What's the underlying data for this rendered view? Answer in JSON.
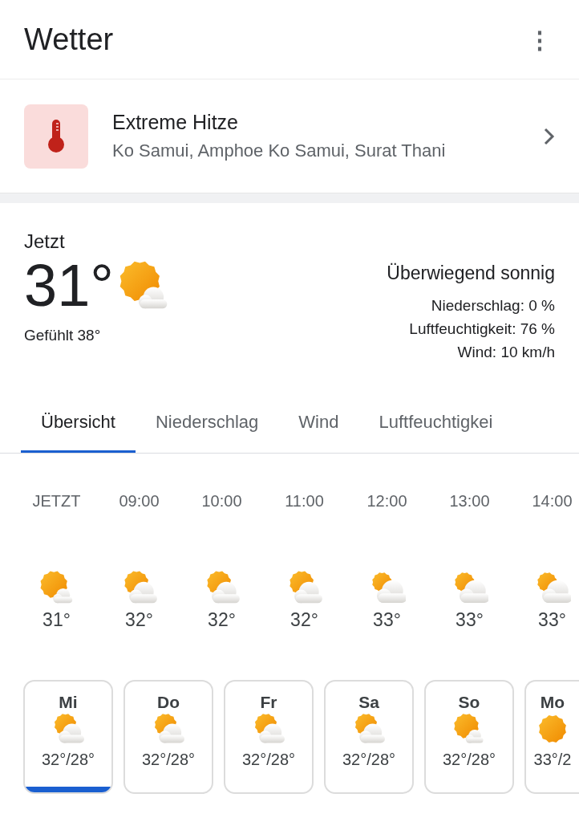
{
  "app_bar": {
    "title": "Wetter",
    "menu_icon": "⋮"
  },
  "alert": {
    "title": "Extreme Hitze",
    "location": "Ko Samui, Amphoe Ko Samui, Surat Thani"
  },
  "current": {
    "label": "Jetzt",
    "temperature": "31°",
    "kind": "mostly-sunny",
    "feels_like": "Gefühlt 38°",
    "condition": "Überwiegend sonnig",
    "details": [
      "Niederschlag: 0 %",
      "Luftfeuchtigkeit: 76 %",
      "Wind: 10 km/h"
    ]
  },
  "tabs": [
    {
      "label": "Übersicht",
      "selected": true
    },
    {
      "label": "Niederschlag",
      "selected": false
    },
    {
      "label": "Wind",
      "selected": false
    },
    {
      "label": "Luftfeuchtigkei",
      "selected": false
    }
  ],
  "hourly": [
    {
      "time": "JETZT",
      "kind": "mostly-sunny",
      "temp": "31°"
    },
    {
      "time": "09:00",
      "kind": "partly-cloudy",
      "temp": "32°"
    },
    {
      "time": "10:00",
      "kind": "partly-cloudy",
      "temp": "32°"
    },
    {
      "time": "11:00",
      "kind": "partly-cloudy",
      "temp": "32°"
    },
    {
      "time": "12:00",
      "kind": "cloudy-sun",
      "temp": "33°"
    },
    {
      "time": "13:00",
      "kind": "cloudy-sun",
      "temp": "33°"
    },
    {
      "time": "14:00",
      "kind": "cloudy-sun",
      "temp": "33°"
    }
  ],
  "days": [
    {
      "day": "Mi",
      "kind": "partly-cloudy",
      "range": "32°/28°",
      "selected": true
    },
    {
      "day": "Do",
      "kind": "partly-cloudy",
      "range": "32°/28°",
      "selected": false
    },
    {
      "day": "Fr",
      "kind": "partly-cloudy",
      "range": "32°/28°",
      "selected": false
    },
    {
      "day": "Sa",
      "kind": "partly-cloudy",
      "range": "32°/28°",
      "selected": false
    },
    {
      "day": "So",
      "kind": "mostly-sunny",
      "range": "32°/28°",
      "selected": false
    },
    {
      "day": "Mo",
      "kind": "sunny",
      "range": "33°/2",
      "selected": false
    }
  ]
}
